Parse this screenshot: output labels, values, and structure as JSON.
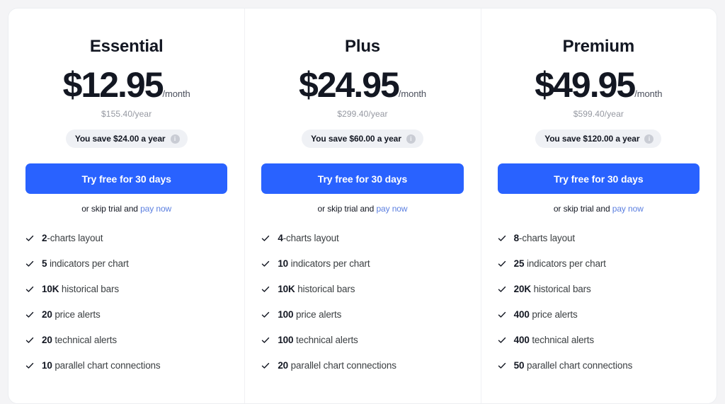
{
  "plans": [
    {
      "name": "Essential",
      "price": "$12.95",
      "period": "/month",
      "annual": "$155.40/year",
      "savings": "You save $24.00 a year",
      "info_icon": "i",
      "cta": "Try free for 30 days",
      "skip_prefix": "or skip trial and ",
      "pay_now": "pay now",
      "features": [
        {
          "value": "2",
          "text": "-charts layout",
          "fill": 32
        },
        {
          "value": "5",
          "text": " indicators per chart",
          "fill": 27
        },
        {
          "value": "10K",
          "text": " historical bars",
          "fill": 45
        },
        {
          "value": "20",
          "text": " price alerts",
          "fill": 3
        },
        {
          "value": "20",
          "text": " technical alerts",
          "fill": 3
        },
        {
          "value": "10",
          "text": " parallel chart connections",
          "fill": 14
        }
      ]
    },
    {
      "name": "Plus",
      "price": "$24.95",
      "period": "/month",
      "annual": "$299.40/year",
      "savings": "You save $60.00 a year",
      "info_icon": "i",
      "cta": "Try free for 30 days",
      "skip_prefix": "or skip trial and ",
      "pay_now": "pay now",
      "features": [
        {
          "value": "4",
          "text": "-charts layout",
          "fill": 50
        },
        {
          "value": "10",
          "text": " indicators per chart",
          "fill": 40
        },
        {
          "value": "10K",
          "text": " historical bars",
          "fill": 45
        },
        {
          "value": "100",
          "text": " price alerts",
          "fill": 17
        },
        {
          "value": "100",
          "text": " technical alerts",
          "fill": 17
        },
        {
          "value": "20",
          "text": " parallel chart connections",
          "fill": 18
        }
      ]
    },
    {
      "name": "Premium",
      "price": "$49.95",
      "period": "/month",
      "annual": "$599.40/year",
      "savings": "You save $120.00 a year",
      "info_icon": "i",
      "cta": "Try free for 30 days",
      "skip_prefix": "or skip trial and ",
      "pay_now": "pay now",
      "features": [
        {
          "value": "8",
          "text": "-charts layout",
          "fill": 67
        },
        {
          "value": "25",
          "text": " indicators per chart",
          "fill": 67
        },
        {
          "value": "20K",
          "text": " historical bars",
          "fill": 67
        },
        {
          "value": "400",
          "text": " price alerts",
          "fill": 56
        },
        {
          "value": "400",
          "text": " technical alerts",
          "fill": 56
        },
        {
          "value": "50",
          "text": " parallel chart connections",
          "fill": 32
        }
      ]
    }
  ]
}
